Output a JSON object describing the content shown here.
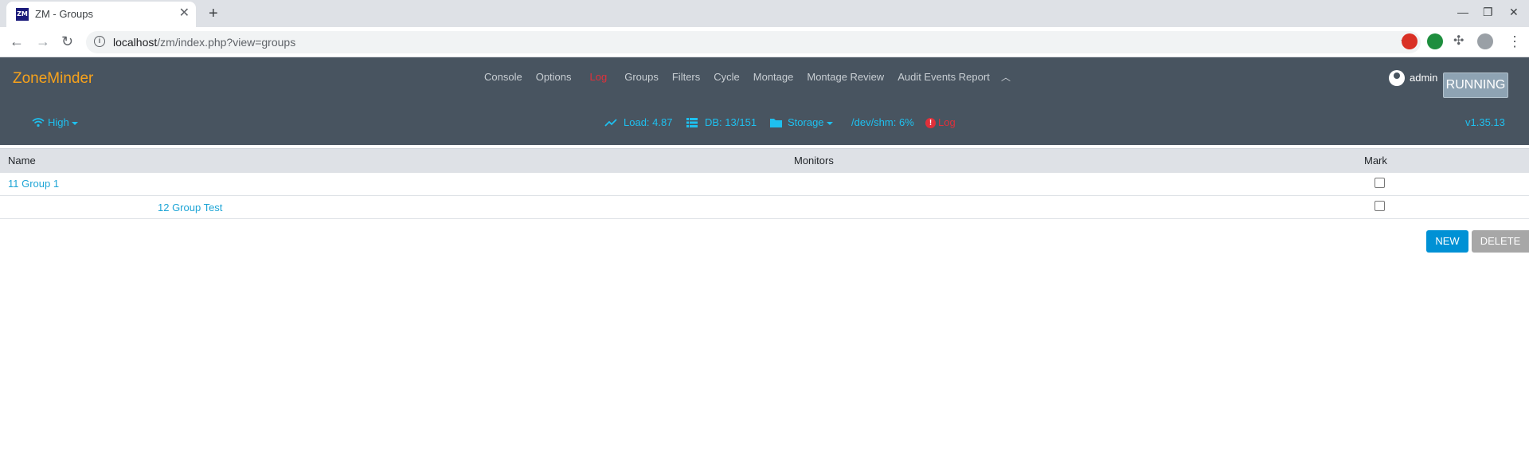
{
  "browser": {
    "tab_title": "ZM - Groups",
    "favicon_text": "ZM",
    "url_host": "localhost",
    "url_path": "/zm/index.php?view=groups"
  },
  "header": {
    "brand": "ZoneMinder",
    "nav": [
      "Console",
      "Options",
      "Log",
      "Groups",
      "Filters",
      "Cycle",
      "Montage",
      "Montage Review",
      "Audit Events Report"
    ],
    "user": "admin",
    "status": "RUNNING",
    "bandwidth": "High",
    "load": "Load: 4.87",
    "db": "DB: 13/151",
    "storage": "Storage",
    "shm": "/dev/shm: 6%",
    "log": "Log",
    "version": "v1.35.13"
  },
  "table": {
    "headers": [
      "Name",
      "Monitors",
      "Mark"
    ],
    "rows": [
      {
        "name": "11 Group 1",
        "monitors": "",
        "checked": false
      },
      {
        "name": "12 Group Test",
        "monitors": "",
        "checked": false
      }
    ]
  },
  "actions": {
    "new_label": "NEW",
    "delete_label": "DELETE"
  },
  "colors": {
    "header_bg": "#485460",
    "brand": "#f7a21b",
    "link": "#1ea5d6",
    "log_red": "#e0303a",
    "new_button": "#0091d5",
    "delete_button": "#a7a7a7"
  }
}
